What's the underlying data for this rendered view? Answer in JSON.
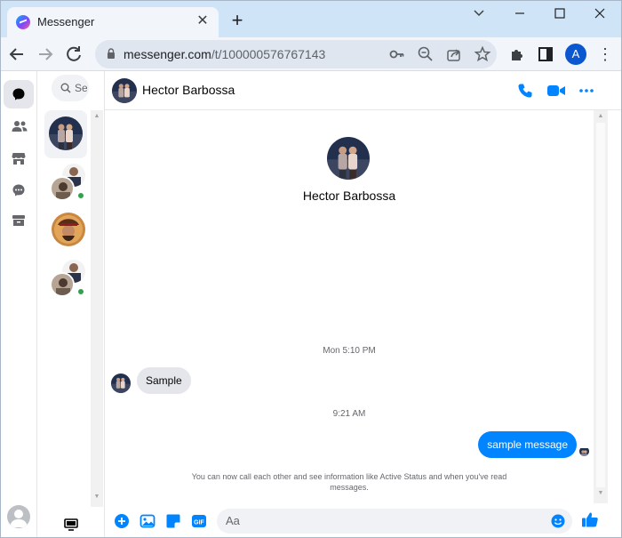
{
  "browser": {
    "tab": {
      "title": "Messenger",
      "favicon": "messenger-logo-icon",
      "close_glyph": "✕"
    },
    "new_tab_glyph": "+",
    "window_controls": {
      "minimize": "—",
      "maximize": "☐",
      "close": "✕",
      "collapse": "⌄"
    },
    "url": {
      "host": "messenger.com",
      "path": "/t/100000576767143"
    },
    "profile_initial": "A",
    "menu_glyph": "⋮",
    "nav": {
      "back": "←",
      "forward": "→",
      "reload": "↻"
    }
  },
  "chat_list": {
    "search_placeholder": "Se",
    "conversations": [
      {
        "avatar": "hector-couple-photo",
        "active": true,
        "online": false
      },
      {
        "avatar": "group-avatar-1",
        "active": false,
        "online": true
      },
      {
        "avatar": "pirate-avatar",
        "active": false,
        "online": false
      },
      {
        "avatar": "group-avatar-2",
        "active": false,
        "online": true
      }
    ]
  },
  "conversation": {
    "contact_name": "Hector Barbossa",
    "profile_name": "Hector Barbossa",
    "timestamps": [
      "Mon 5:10 PM",
      "9:21 AM"
    ],
    "messages": [
      {
        "direction": "in",
        "text": "Sample"
      },
      {
        "direction": "out",
        "text": "sample message"
      }
    ],
    "notice": "You can now call each other and see information like Active Status and when you've read messages."
  },
  "composer": {
    "placeholder": "Aa"
  },
  "colors": {
    "accent": "#0084ff",
    "titlebar": "#cfe4f7",
    "toolbar": "#f2f6fb",
    "online": "#31a24c"
  }
}
